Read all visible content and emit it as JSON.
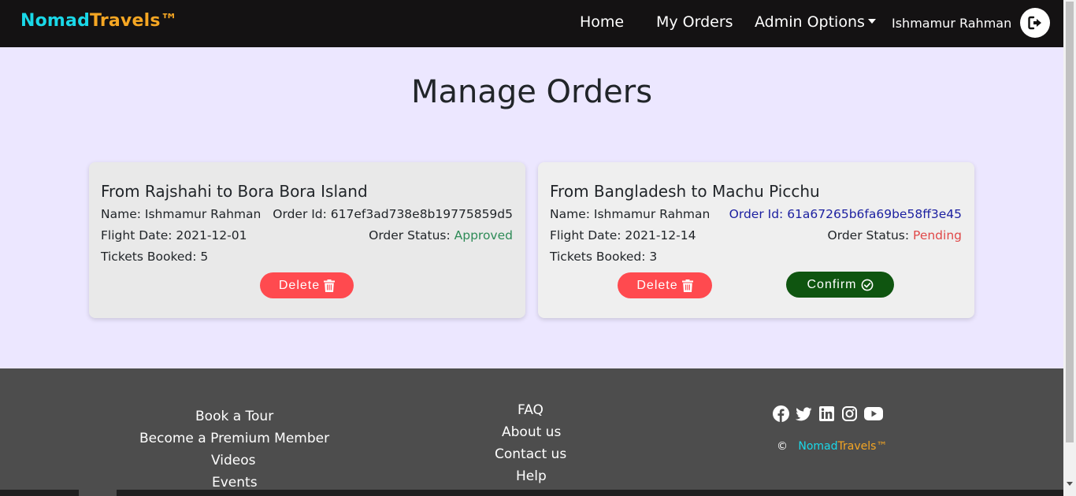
{
  "navbar": {
    "brand_part1": "Nomad",
    "brand_part2": "Travels™",
    "home": "Home",
    "my_orders": "My Orders",
    "admin_options": "Admin Options",
    "user_name": "Ishmamur Rahman",
    "logout_icon": "sign-out-icon"
  },
  "main": {
    "title": "Manage Orders"
  },
  "orders": [
    {
      "title": "From Rajshahi to Bora Bora Island",
      "name": "Name: Ishmamur Rahman",
      "order_id_label": "Order Id: 617ef3ad738e8b19775859d5",
      "flight_date": "Flight Date: 2021-12-01",
      "status_label": "Order Status: ",
      "status_value": "Approved",
      "tickets": "Tickets Booked: 5",
      "delete_label": "Delete"
    },
    {
      "title": "From Bangladesh to Machu Picchu",
      "name": "Name: Ishmamur Rahman",
      "order_id_label": "Order Id: 61a67265b6fa69be58ff3e45",
      "flight_date": "Flight Date: 2021-12-14",
      "status_label": "Order Status: ",
      "status_value": "Pending",
      "tickets": "Tickets Booked: 3",
      "delete_label": "Delete",
      "confirm_label": "Confirm"
    }
  ],
  "footer": {
    "col1": [
      "Book a Tour",
      "Become a Premium Member",
      "Videos",
      "Events"
    ],
    "col2": [
      "FAQ",
      "About us",
      "Contact us",
      "Help"
    ],
    "social_icons": [
      "facebook-icon",
      "twitter-icon",
      "linkedin-icon",
      "instagram-icon",
      "youtube-icon"
    ],
    "copyright_symbol": "©",
    "brand_part1": "Nomad",
    "brand_part2": "Travels™"
  },
  "colors": {
    "navbar_bg": "#141213",
    "page_bg": "#ece7ff",
    "brand_cyan": "#1ad8e8",
    "brand_orange": "#f5a623",
    "approved": "#2e8b57",
    "pending": "#e04848",
    "delete_btn": "#ff4a4f",
    "confirm_btn": "#0f5510",
    "footer_bg": "#4d4d4d"
  }
}
